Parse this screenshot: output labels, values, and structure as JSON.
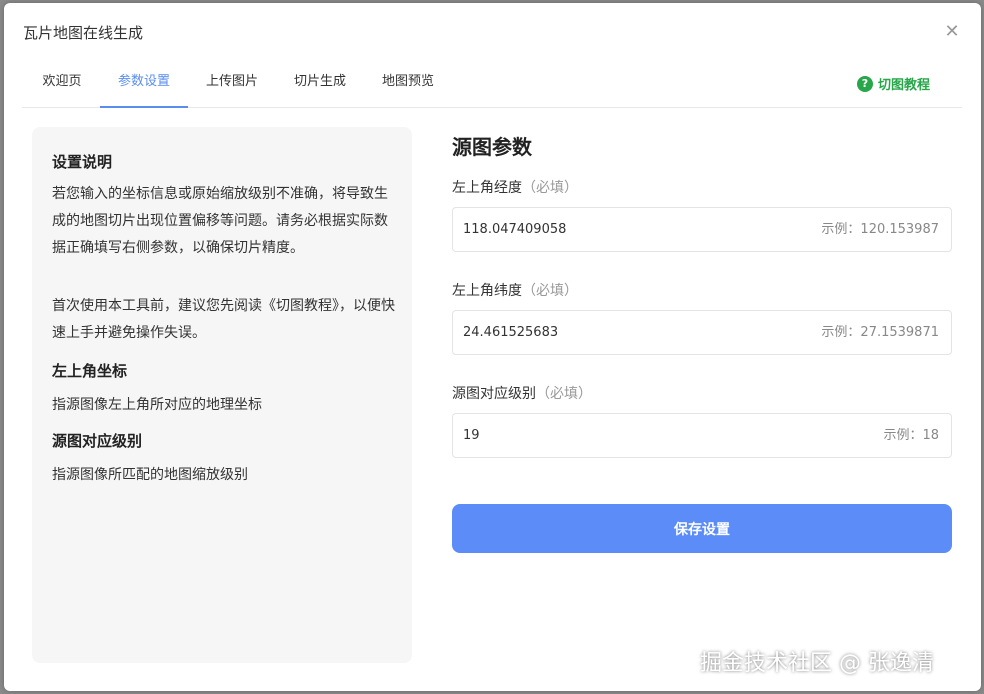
{
  "dialog": {
    "title": "瓦片地图在线生成",
    "close_icon": "close-icon"
  },
  "tabs": [
    {
      "label": "欢迎页",
      "active": false
    },
    {
      "label": "参数设置",
      "active": true
    },
    {
      "label": "上传图片",
      "active": false
    },
    {
      "label": "切片生成",
      "active": false
    },
    {
      "label": "地图预览",
      "active": false
    }
  ],
  "tutorial": {
    "icon": "help-circle-icon",
    "label": "切图教程"
  },
  "info": {
    "heading_settings": "设置说明",
    "para1": "若您输入的坐标信息或原始缩放级别不准确，将导致生成的地图切片出现位置偏移等问题。请务必根据实际数据正确填写右侧参数，以确保切片精度。",
    "para2": "首次使用本工具前，建议您先阅读《切图教程》，以便快速上手并避免操作失误。",
    "heading_corner": "左上角坐标",
    "desc_corner": "指源图像左上角所对应的地理坐标",
    "heading_level": "源图对应级别",
    "desc_level": "指源图像所匹配的地图缩放级别"
  },
  "form": {
    "title": "源图参数",
    "longitude": {
      "label": "左上角经度",
      "required": "（必填）",
      "value": "118.047409058",
      "example": "示例：120.153987"
    },
    "latitude": {
      "label": "左上角纬度",
      "required": "（必填）",
      "value": "24.461525683",
      "example": "示例：27.1539871"
    },
    "level": {
      "label": "源图对应级别",
      "required": "（必填）",
      "value": "19",
      "example": "示例：18"
    },
    "save_label": "保存设置"
  },
  "watermark": "掘金技术社区 @ 张逸清",
  "colors": {
    "accent": "#5b8def",
    "button": "#5b8cf7",
    "tutorial_green": "#27a64a"
  }
}
